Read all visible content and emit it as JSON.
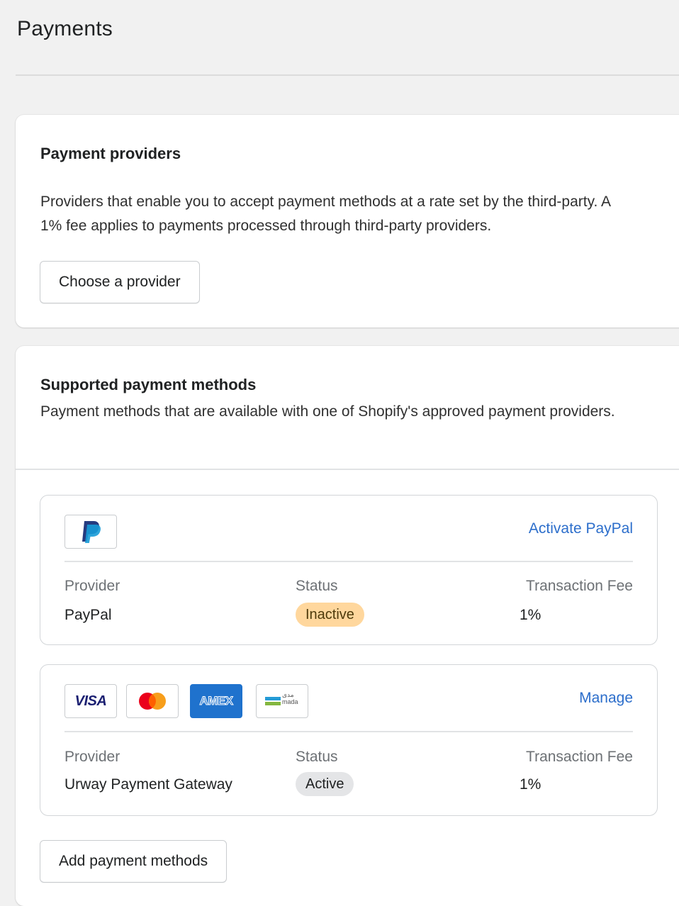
{
  "page": {
    "title": "Payments"
  },
  "providers_card": {
    "heading": "Payment providers",
    "description": "Providers that enable you to accept payment methods at a rate set by the third-party. A 1% fee applies to payments processed through third-party providers.",
    "button_label": "Choose a provider"
  },
  "methods_card": {
    "heading": "Supported payment methods",
    "description": "Payment methods that are available with one of Shopify's approved payment providers.",
    "column_labels": {
      "provider": "Provider",
      "status": "Status",
      "fee": "Transaction Fee"
    },
    "methods": [
      {
        "logos": [
          "paypal-logo"
        ],
        "action_label": "Activate PayPal",
        "provider": "PayPal",
        "status": "Inactive",
        "fee": "1%"
      },
      {
        "logos": [
          "visa-logo",
          "mastercard-logo",
          "amex-logo",
          "mada-logo"
        ],
        "logo_text": {
          "visa": "VISA",
          "amex": "AMEX",
          "mada_ar": "مدى",
          "mada": "mada"
        },
        "action_label": "Manage",
        "provider": "Urway Payment Gateway",
        "status": "Active",
        "fee": "1%"
      }
    ],
    "add_button_label": "Add payment methods"
  },
  "colors": {
    "link": "#2c6ecb",
    "badge_inactive": "#ffd79d",
    "badge_active": "#e4e5e7",
    "paypal_dark": "#253b80",
    "paypal_light": "#179bd7",
    "amex_blue": "#1f72cd",
    "visa_blue": "#1a1f71"
  }
}
